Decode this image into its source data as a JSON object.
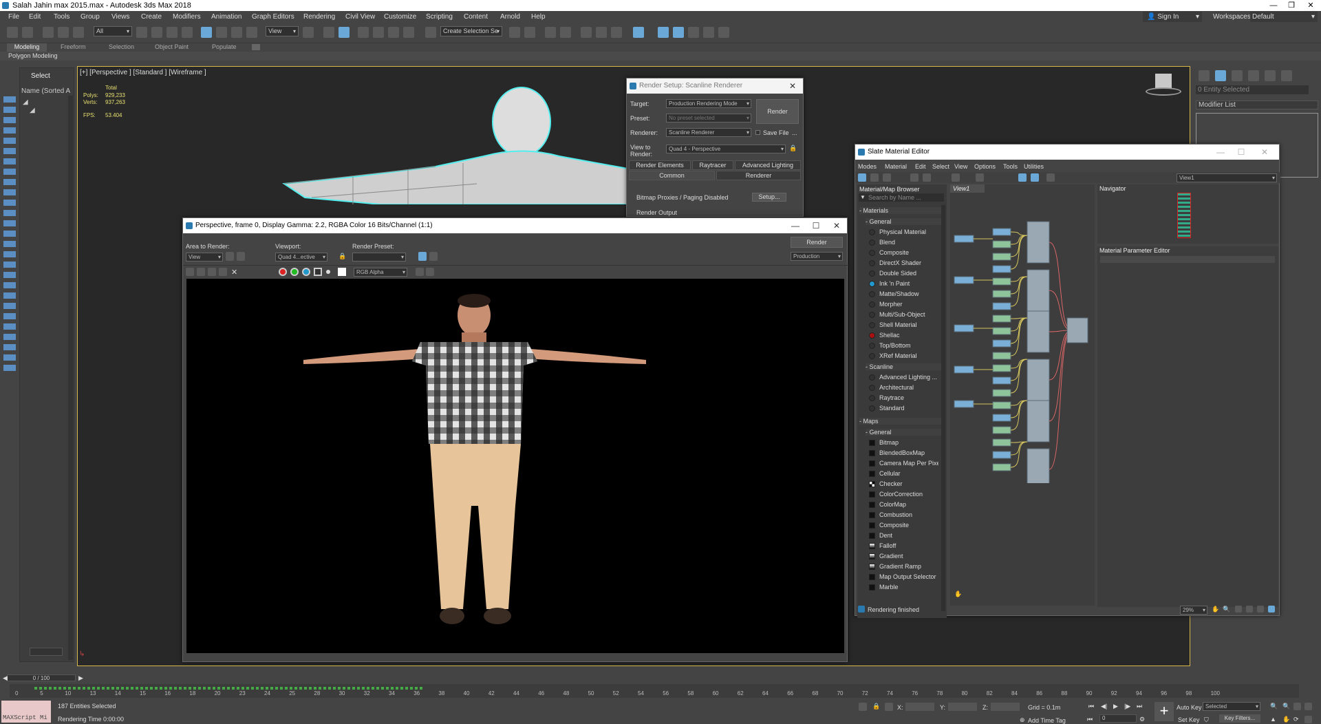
{
  "app": {
    "title": "Salah Jahin max 2015.max - Autodesk 3ds Max 2018"
  },
  "menu": [
    "File",
    "Edit",
    "Tools",
    "Group",
    "Views",
    "Create",
    "Modifiers",
    "Animation",
    "Graph Editors",
    "Rendering",
    "Civil View",
    "Customize",
    "Scripting",
    "Content",
    "Arnold",
    "Help"
  ],
  "account": {
    "signin": "Sign In",
    "workspaces_label": "Workspaces:",
    "workspace": "Default"
  },
  "toolbar": {
    "filter": "All",
    "refcoord": "View",
    "selection_set": "Create Selection Se"
  },
  "ribbon": {
    "tabs": [
      "Modeling",
      "Freeform",
      "Selection",
      "Object Paint",
      "Populate"
    ],
    "sub": "Polygon Modeling"
  },
  "explorer": {
    "title": "Select",
    "column": "Name (Sorted A"
  },
  "viewport": {
    "label": "[+] [Perspective ] [Standard ] [Wireframe ]",
    "stats": {
      "total": "Total",
      "polys_label": "Polys:",
      "polys": "929,233",
      "verts_label": "Verts:",
      "verts": "937,263",
      "fps_label": "FPS:",
      "fps": "53.404"
    }
  },
  "render_setup": {
    "title": "Render Setup: Scanline Renderer",
    "target_label": "Target:",
    "target": "Production Rendering Mode",
    "preset_label": "Preset:",
    "preset": "No preset selected",
    "renderer_label": "Renderer:",
    "renderer": "Scanline Renderer",
    "savefile": "Save File",
    "view_label": "View to Render:",
    "view": "Quad 4 - Perspective",
    "render": "Render",
    "tabs": [
      "Render Elements",
      "Raytracer",
      "Advanced Lighting",
      "Common",
      "Renderer"
    ],
    "bitmap": "Bitmap Proxies / Paging Disabled",
    "setup": "Setup...",
    "render_output": "Render Output"
  },
  "frame_window": {
    "title": "Perspective, frame 0, Display Gamma: 2.2, RGBA Color 16 Bits/Channel (1:1)",
    "area_label": "Area to Render:",
    "area": "View",
    "viewport_label": "Viewport:",
    "viewport": "Quad 4...ective",
    "preset_label": "Render Preset:",
    "preset": "",
    "render": "Render",
    "mode": "Production",
    "channel": "RGB Alpha"
  },
  "slate": {
    "title": "Slate Material Editor",
    "menu": [
      "Modes",
      "Material",
      "Edit",
      "Select",
      "View",
      "Options",
      "Tools",
      "Utilities"
    ],
    "view_select": "View1",
    "browser_title": "Material/Map Browser",
    "search": "Search by Name ...",
    "view_tab": "View1",
    "navigator": "Navigator",
    "param_editor": "Material Parameter Editor",
    "status": "Rendering finished",
    "zoom": "29%",
    "materials_header": "Materials",
    "general": "General",
    "materials": [
      "Physical Material",
      "Blend",
      "Composite",
      "DirectX Shader",
      "Double Sided",
      "Ink 'n Paint",
      "Matte/Shadow",
      "Morpher",
      "Multi/Sub-Object",
      "Shell Material",
      "Shellac",
      "Top/Bottom",
      "XRef Material"
    ],
    "scanline_header": "Scanline",
    "scanline": [
      "Advanced Lighting ...",
      "Architectural",
      "Raytrace",
      "Standard"
    ],
    "maps_header": "Maps",
    "maps_general": "General",
    "maps": [
      "Bitmap",
      "BlendedBoxMap",
      "Camera Map Per Pixel",
      "Cellular",
      "Checker",
      "ColorCorrection",
      "ColorMap",
      "Combustion",
      "Composite",
      "Dent",
      "Falloff",
      "Gradient",
      "Gradient Ramp",
      "Map Output Selector",
      "Marble"
    ]
  },
  "cmd": {
    "entity": "0 Entity Selected",
    "modlist": "Modifier List"
  },
  "timeline": {
    "frame": "0 / 100",
    "ticks": [
      "0",
      "5",
      "10",
      "13",
      "14",
      "15",
      "16",
      "18",
      "20",
      "23",
      "24",
      "25",
      "28",
      "30",
      "32",
      "34",
      "36",
      "38",
      "40",
      "42",
      "44",
      "46",
      "48",
      "50",
      "52",
      "54",
      "56",
      "58",
      "60",
      "62",
      "64",
      "66",
      "68",
      "70",
      "72",
      "74",
      "76",
      "78",
      "80",
      "82",
      "84",
      "86",
      "88",
      "90",
      "92",
      "94",
      "96",
      "98",
      "100"
    ]
  },
  "status": {
    "maxscript": "MAXScript Mi",
    "selected": "187 Entities Selected",
    "rendertime": "Rendering Time  0:00:00",
    "x": "X:",
    "y": "Y:",
    "z": "Z:",
    "grid": "Grid = 0.1m",
    "addtime": "Add Time Tag",
    "autokey": "Auto Key",
    "setkey": "Set Key",
    "selected_dd": "Selected",
    "keyfilters": "Key Filters...",
    "frame_field": "0"
  }
}
